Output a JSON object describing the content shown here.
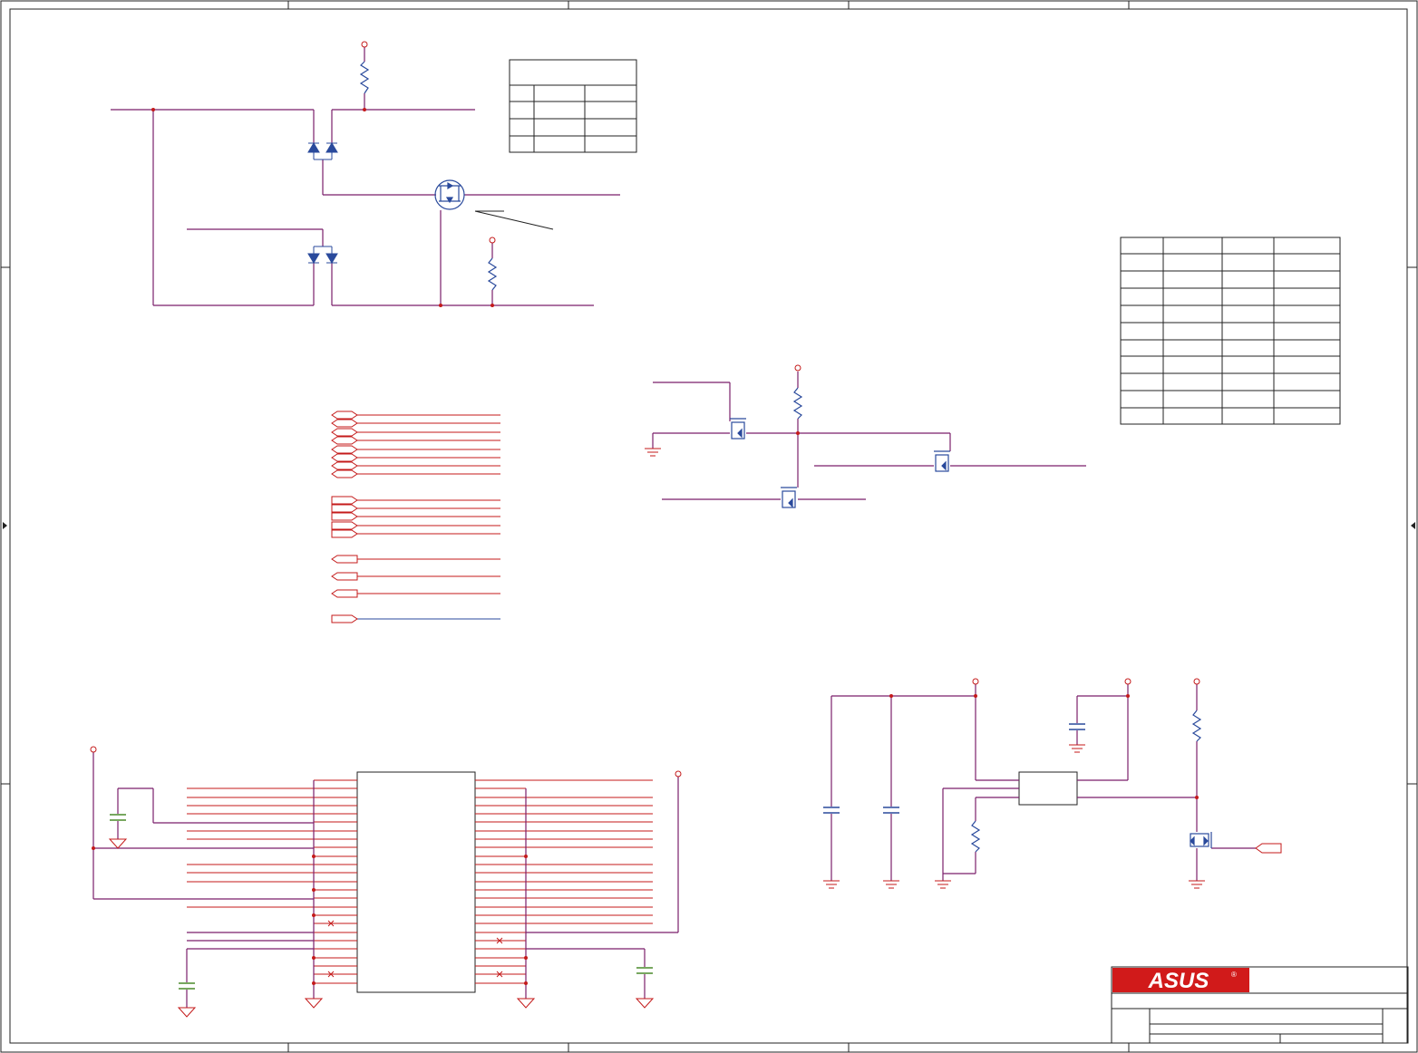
{
  "title_block": {
    "logo_text": "ASUS",
    "registered_mark": "®"
  },
  "colors": {
    "wire": "#7a1f6b",
    "pin": "#c41a1a",
    "component": "#2a4a9c",
    "capacitor": "#4a8a2a",
    "border": "#222222"
  },
  "icons": [
    "diode-pair-icon",
    "mosfet-icon",
    "resistor-icon",
    "capacitor-icon",
    "ground-icon",
    "power-pin-icon",
    "port-arrow-icon",
    "asus-logo"
  ]
}
